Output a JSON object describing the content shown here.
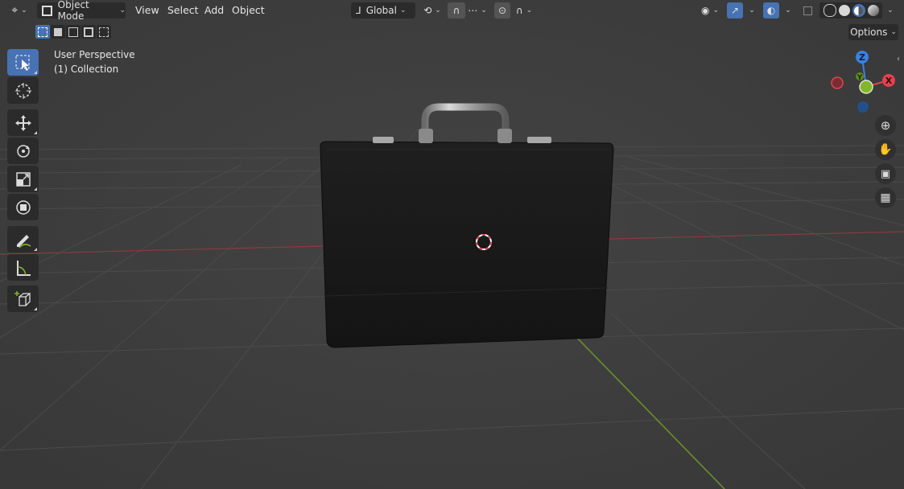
{
  "header": {
    "mode_label": "Object Mode",
    "menus": [
      "View",
      "Select",
      "Add",
      "Object"
    ],
    "orientation_label": "Global",
    "options_label": "Options"
  },
  "overlay": {
    "view_name": "User Perspective",
    "collection": "(1) Collection"
  },
  "gizmo": {
    "z_label": "Z",
    "y_label": "Y",
    "x_label": "X",
    "colors": {
      "x": "#e0434f",
      "y": "#82b62c",
      "z": "#3a82e0"
    }
  },
  "icons": {
    "editor_type": "editor-type-icon",
    "select_box": "select-box-icon",
    "cursor": "cursor-icon",
    "move": "move-icon",
    "rotate": "rotate-icon",
    "scale": "scale-icon",
    "transform": "transform-icon",
    "annotate": "annotate-icon",
    "measure": "measure-icon",
    "add_cube": "add-cube-icon"
  }
}
